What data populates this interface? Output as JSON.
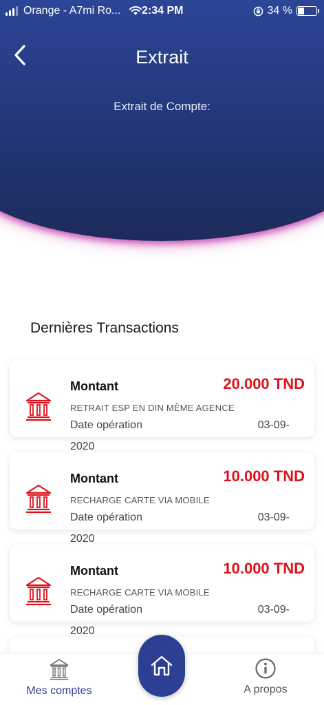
{
  "status_bar": {
    "carrier": "Orange - A7mi Ro...",
    "time": "2:34 PM",
    "battery": "34 %"
  },
  "header": {
    "title": "Extrait",
    "subtitle": "Extrait de Compte:"
  },
  "section_title": "Dernières Transactions",
  "transactions": [
    {
      "label": "Montant",
      "amount": "20.000 TND",
      "description": "RETRAIT ESP EN DIN MÊME AGENCE",
      "date_label": "Date opération",
      "date_value": "03-09-",
      "date_year": "2020"
    },
    {
      "label": "Montant",
      "amount": "10.000 TND",
      "description": "RECHARGE CARTE VIA MOBILE",
      "date_label": "Date opération",
      "date_value": "03-09-",
      "date_year": "2020"
    },
    {
      "label": "Montant",
      "amount": "10.000 TND",
      "description": "RECHARGE CARTE VIA MOBILE",
      "date_label": "Date opération",
      "date_value": "03-09-",
      "date_year": "2020"
    }
  ],
  "bottom_nav": {
    "accounts_label": "Mes comptes",
    "about_label": "A propos"
  },
  "colors": {
    "header_blue": "#223677",
    "amount_red": "#e0101a",
    "accent_magenta": "#c43caa",
    "nav_blue": "#2d3f93"
  },
  "icons": {
    "back": "chevron-left-icon",
    "transaction": "bank-icon",
    "accounts": "bank-icon",
    "home": "home-icon",
    "about": "info-icon"
  }
}
